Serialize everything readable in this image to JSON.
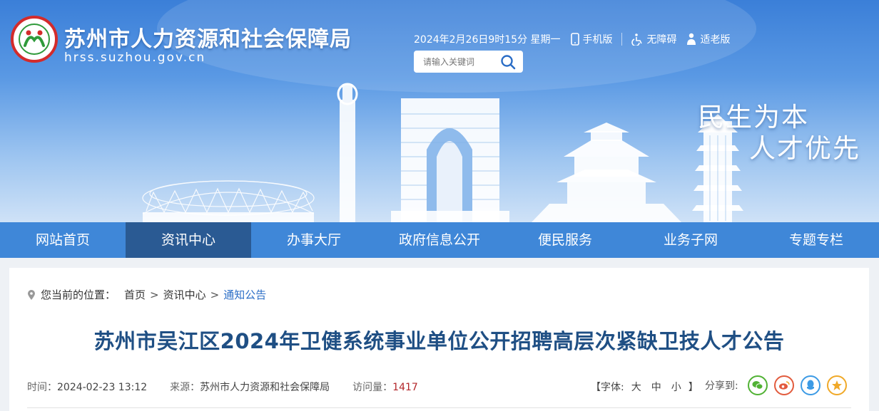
{
  "site": {
    "title": "苏州市人力资源和社会保障局",
    "url": "hrss.suzhou.gov.cn"
  },
  "topbar": {
    "datetime": "2024年2月26日9时15分",
    "weekday": "星期一",
    "mobile": "手机版",
    "accessible": "无障碍",
    "elderly": "适老版"
  },
  "search": {
    "placeholder": "请输入关键词"
  },
  "slogan": {
    "line1": "民生为本",
    "line2": "人才优先"
  },
  "nav": {
    "items": [
      {
        "label": "网站首页"
      },
      {
        "label": "资讯中心"
      },
      {
        "label": "办事大厅"
      },
      {
        "label": "政府信息公开"
      },
      {
        "label": "便民服务"
      },
      {
        "label": "业务子网"
      },
      {
        "label": "专题专栏"
      }
    ],
    "active_index": 1
  },
  "breadcrumb": {
    "prefix": "您当前的位置：",
    "items": [
      "首页",
      "资讯中心",
      "通知公告"
    ],
    "separator": ">"
  },
  "article": {
    "title": "苏州市吴江区2024年卫健系统事业单位公开招聘高层次紧缺卫技人才公告",
    "time_label": "时间：",
    "time": "2024-02-23 13:12",
    "source_label": "来源：",
    "source": "苏州市人力资源和社会保障局",
    "views_label": "访问量：",
    "views": "1417"
  },
  "font_size": {
    "open": "【字体:",
    "large": "大",
    "medium": "中",
    "small": "小",
    "close": "】"
  },
  "share": {
    "label": "分享到:",
    "icons": [
      "wechat-icon",
      "weibo-icon",
      "qq-icon",
      "favorite-icon"
    ]
  },
  "colors": {
    "nav_bg": "#3f87d8",
    "nav_active": "#2a5a93",
    "title_color": "#1f4f84",
    "views_color": "#b3262a"
  }
}
